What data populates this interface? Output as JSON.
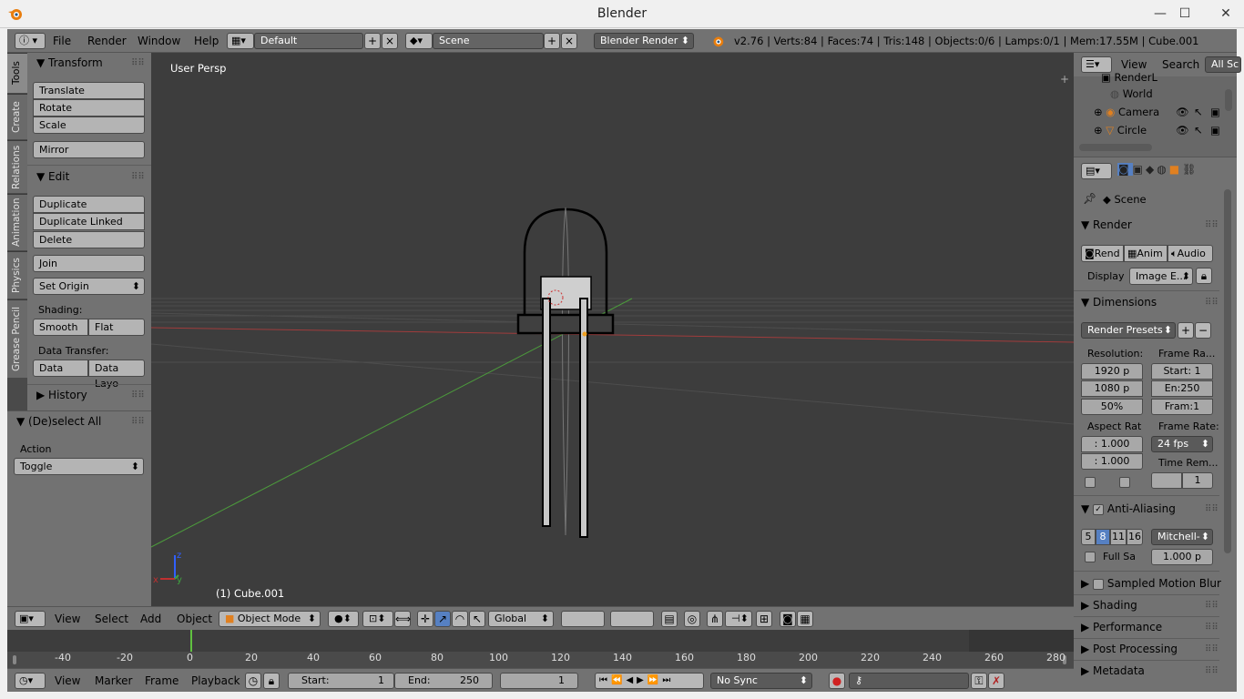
{
  "window": {
    "title": "Blender",
    "minimize": "—",
    "maximize": "☐",
    "close": "✕"
  },
  "info_header": {
    "menus": [
      "File",
      "Render",
      "Window",
      "Help"
    ],
    "layout": "Default",
    "scene": "Scene",
    "engine": "Blender Render",
    "stats": "v2.76 | Verts:84 | Faces:74 | Tris:148 | Objects:0/6 | Lamps:0/1 | Mem:17.55M | Cube.001"
  },
  "tool_tabs": [
    "Tools",
    "Create",
    "Relations",
    "Animation",
    "Physics",
    "Grease Pencil"
  ],
  "tool_shelf": {
    "transform_title": "Transform",
    "translate": "Translate",
    "rotate": "Rotate",
    "scale": "Scale",
    "mirror": "Mirror",
    "edit_title": "Edit",
    "duplicate": "Duplicate",
    "duplicate_linked": "Duplicate Linked",
    "delete": "Delete",
    "join": "Join",
    "set_origin": "Set Origin",
    "shading_label": "Shading:",
    "smooth": "Smooth",
    "flat": "Flat",
    "data_transfer_label": "Data Transfer:",
    "data": "Data",
    "data_layout": "Data Layo",
    "history_title": "History"
  },
  "operator_panel": {
    "title": "(De)select All",
    "action_label": "Action",
    "action_value": "Toggle"
  },
  "viewport": {
    "view_label": "User Persp",
    "object_label": "(1) Cube.001"
  },
  "view3d_header": {
    "menus": [
      "View",
      "Select",
      "Add",
      "Object"
    ],
    "mode": "Object Mode",
    "orientation": "Global"
  },
  "timeline": {
    "ticks": [
      "-40",
      "-20",
      "0",
      "20",
      "40",
      "60",
      "80",
      "100",
      "120",
      "140",
      "160",
      "180",
      "200",
      "220",
      "240",
      "260",
      "280"
    ],
    "current_frame": 1
  },
  "timeline_header": {
    "menus": [
      "View",
      "Marker",
      "Frame",
      "Playback"
    ],
    "start_label": "Start:",
    "start_value": "1",
    "end_label": "End:",
    "end_value": "250",
    "frame_value": "1",
    "sync": "No Sync"
  },
  "outliner": {
    "menus": [
      "View",
      "Search"
    ],
    "filter": "All Sc",
    "items": [
      "RenderL",
      "World",
      "Camera",
      "Circle"
    ]
  },
  "properties": {
    "context": "Scene",
    "render_title": "Render",
    "render_btn": "Rend",
    "anim_btn": "Anim",
    "audio_btn": "Audio",
    "display_label": "Display",
    "display_value": "Image E...",
    "dimensions_title": "Dimensions",
    "render_presets": "Render Presets",
    "resolution_label": "Resolution:",
    "res_x": "1920 p",
    "res_y": "1080 p",
    "res_pct": "50%",
    "frame_range_label": "Frame Ra...",
    "frame_start": "Start: 1",
    "frame_end": "En:250",
    "frame_step": "Fram:1",
    "aspect_label": "Aspect Rat",
    "aspect_x": ": 1.000",
    "aspect_y": ": 1.000",
    "frame_rate_label": "Frame Rate:",
    "frame_rate": "24 fps",
    "time_remap_label": "Time Rem...",
    "time_remap_value": "1",
    "aa_title": "Anti-Aliasing",
    "aa_samples": [
      "5",
      "8",
      "11",
      "16"
    ],
    "aa_filter": "Mitchell-",
    "full_sample": "Full Sa",
    "filter_size": "1.000 p",
    "sections": [
      "Sampled Motion Blur",
      "Shading",
      "Performance",
      "Post Processing",
      "Metadata"
    ]
  }
}
